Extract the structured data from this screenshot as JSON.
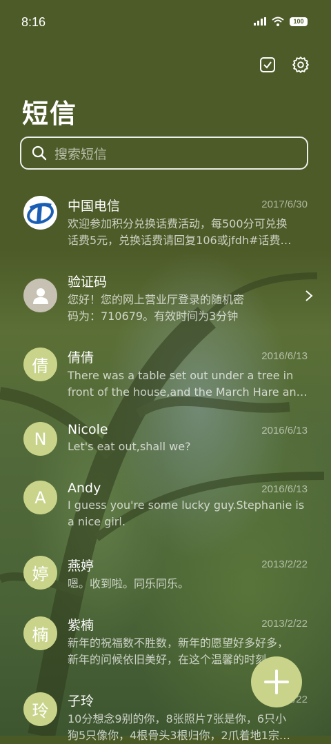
{
  "status_bar": {
    "time": "8:16",
    "battery": "100"
  },
  "header": {
    "title": "短信"
  },
  "search": {
    "placeholder": "搜索短信"
  },
  "conversations": [
    {
      "name": "中国电信",
      "date": "2017/6/30",
      "preview_line1": "欢迎参加积分兑换话费活动，每500分可兑换",
      "preview_line2": "话费5元，兑换话费请回复106或jfdh#话费…",
      "avatar_type": "logo"
    },
    {
      "name": "验证码",
      "date": "",
      "preview_line1": "您好！您的网上营业厅登录的随机密",
      "preview_line2": "码为：710679。有效时间为3分钟",
      "avatar_type": "person"
    },
    {
      "name": "倩倩",
      "date": "2016/6/13",
      "preview_line1": "There was a table set out under a tree in",
      "preview_line2": "front of the house,and the March Hare an…",
      "avatar_letter": "倩"
    },
    {
      "name": "Nicole",
      "date": "2016/6/13",
      "preview_line1": "Let's eat out,shall we?",
      "preview_line2": "",
      "avatar_letter": "N"
    },
    {
      "name": "Andy",
      "date": "2016/6/13",
      "preview_line1": "I guess you're some lucky guy.Stephanie is",
      "preview_line2": "a nice girl.",
      "avatar_letter": "A"
    },
    {
      "name": "燕婷",
      "date": "2013/2/22",
      "preview_line1": "嗯。收到啦。同乐同乐。",
      "preview_line2": "",
      "avatar_letter": "婷"
    },
    {
      "name": "紫楠",
      "date": "2013/2/22",
      "preview_line1": "新年的祝福数不胜数，新年的愿望好多好多，",
      "preview_line2": "新年的问候依旧美好，在这个温馨的时刻…",
      "avatar_letter": "楠"
    },
    {
      "name": "子玲",
      "date": "2013/2/22",
      "preview_line1": "10分想念9别的你，8张照片7张是你，6只小",
      "preview_line2": "狗5只像你，4根骨头3根归你，2爪着地1宗…",
      "avatar_letter": "玲"
    }
  ],
  "colors": {
    "accent": "#c9d48a",
    "background": "#4a5a26"
  }
}
